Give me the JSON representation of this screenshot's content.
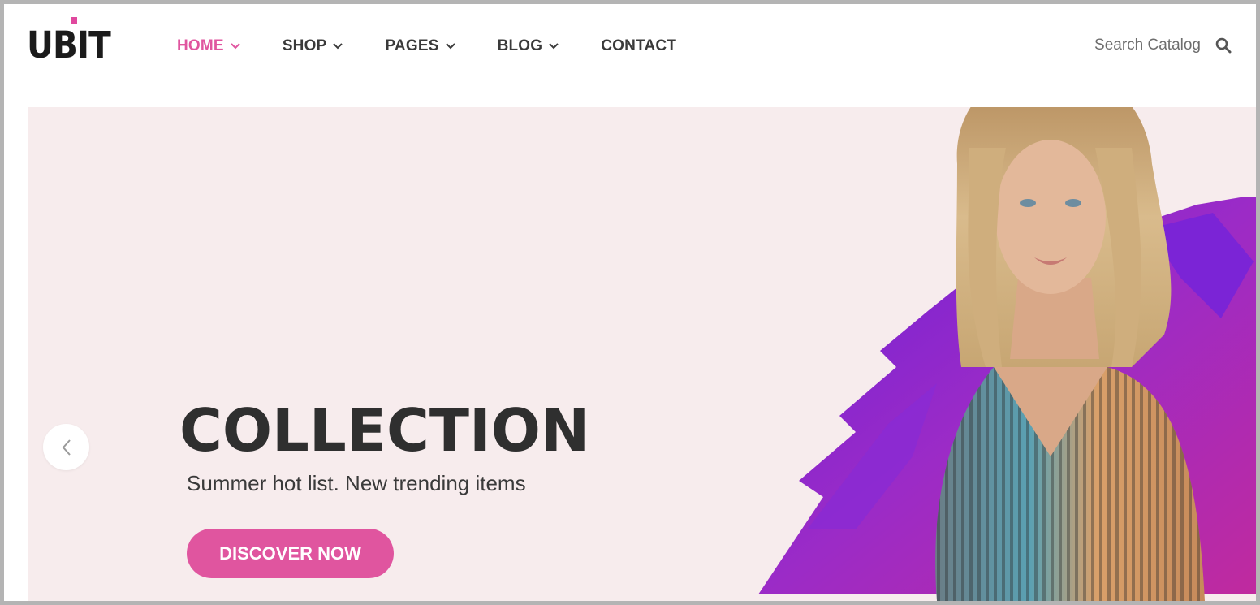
{
  "brand": {
    "logo_text": "UBIT",
    "accent_color": "#e0559f"
  },
  "nav": {
    "items": [
      {
        "label": "HOME",
        "has_dropdown": true,
        "active": true
      },
      {
        "label": "SHOP",
        "has_dropdown": true,
        "active": false
      },
      {
        "label": "PAGES",
        "has_dropdown": true,
        "active": false
      },
      {
        "label": "BLOG",
        "has_dropdown": true,
        "active": false
      },
      {
        "label": "CONTACT",
        "has_dropdown": false,
        "active": false
      }
    ]
  },
  "search": {
    "placeholder": "Search Catalog",
    "icon": "search-icon"
  },
  "hero": {
    "headline": "COLLECTION",
    "subheadline": "Summer hot list. New trending items",
    "cta_label": "DISCOVER NOW",
    "prev_icon": "chevron-left-icon",
    "background_color": "#f7eced",
    "image": "model-photo"
  }
}
